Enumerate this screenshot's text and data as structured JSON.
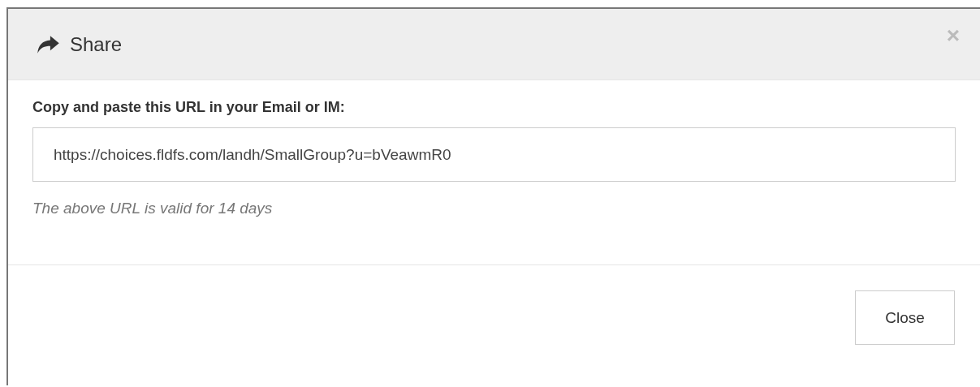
{
  "dialog": {
    "title": "Share",
    "close_glyph": "×",
    "label": "Copy and paste this URL in your Email or IM:",
    "url_value": "https://choices.fldfs.com/landh/SmallGroup?u=bVeawmR0",
    "hint": "The above URL is valid for 14 days",
    "buttons": [
      "Close"
    ]
  }
}
